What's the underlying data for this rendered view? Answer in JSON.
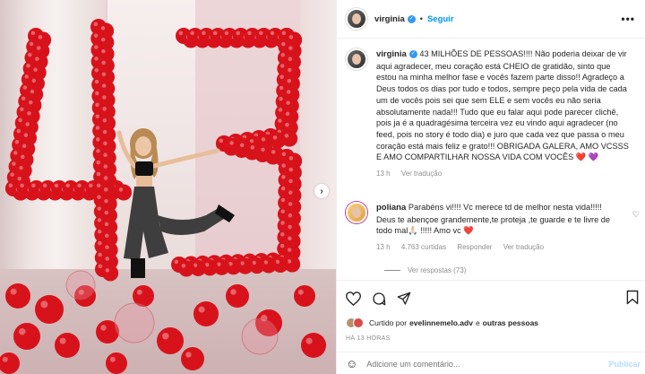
{
  "post": {
    "author": "virginia",
    "follow_label": "Seguir",
    "separator": "•",
    "more_label": "•••"
  },
  "caption": {
    "author": "virginia",
    "text": "43 MILHÕES DE PESSOAS!!!! Não poderia deixar de vir aqui agradecer, meu coração está CHEIO de gratidão, sinto que estou na minha melhor fase e vocês fazem parte disso!! Agradeço a Deus todos os dias por tudo e todos, sempre peço pela vida de cada um de vocês pois sei que sem ELE e sem vocês eu não seria absolutamente nada!!! Tudo que eu falar aqui pode parecer clichê, pois ja é a quadragésima terceira vez eu vindo aqui agradecer (no feed, pois no story é todo dia) e juro que cada vez que passa o meu coração está mais feliz e grato!!! OBRIGADA GALERA, AMO VCSSS E AMO COMPARTILHAR NOSSA VIDA COM VOCÊS",
    "emoji_heart": "❤️",
    "emoji_purple": "💜",
    "time": "13 h",
    "translate": "Ver tradução"
  },
  "comment": {
    "author": "poliana",
    "text": "Parabéns vi!!!! Vc merece td de melhor nesta vida!!!!! Deus te abençoe grandemente,te proteja ,te guarde e te livre de todo mal🙏🏻 !!!!! Amo vc",
    "emoji_heart": "❤️",
    "time": "13 h",
    "likes": "4.763 curtidas",
    "reply": "Responder",
    "translate": "Ver tradução",
    "view_replies": "Ver respostas (73)",
    "heart_icon": "♡"
  },
  "actions": {
    "liked_prefix": "Curtido por",
    "liked_user": "evelinnemelo.adv",
    "liked_and": "e",
    "liked_others": "outras pessoas",
    "timestamp": "HÁ 13 HORAS"
  },
  "add_comment": {
    "placeholder": "Adicione um comentário...",
    "post_label": "Publicar"
  },
  "photo": {
    "next_icon": "›",
    "balloon_color": "#d8121b",
    "big_number": "43"
  },
  "colors": {
    "link": "#0095f6",
    "verified": "#3897f0",
    "muted": "#8e8e8e"
  }
}
